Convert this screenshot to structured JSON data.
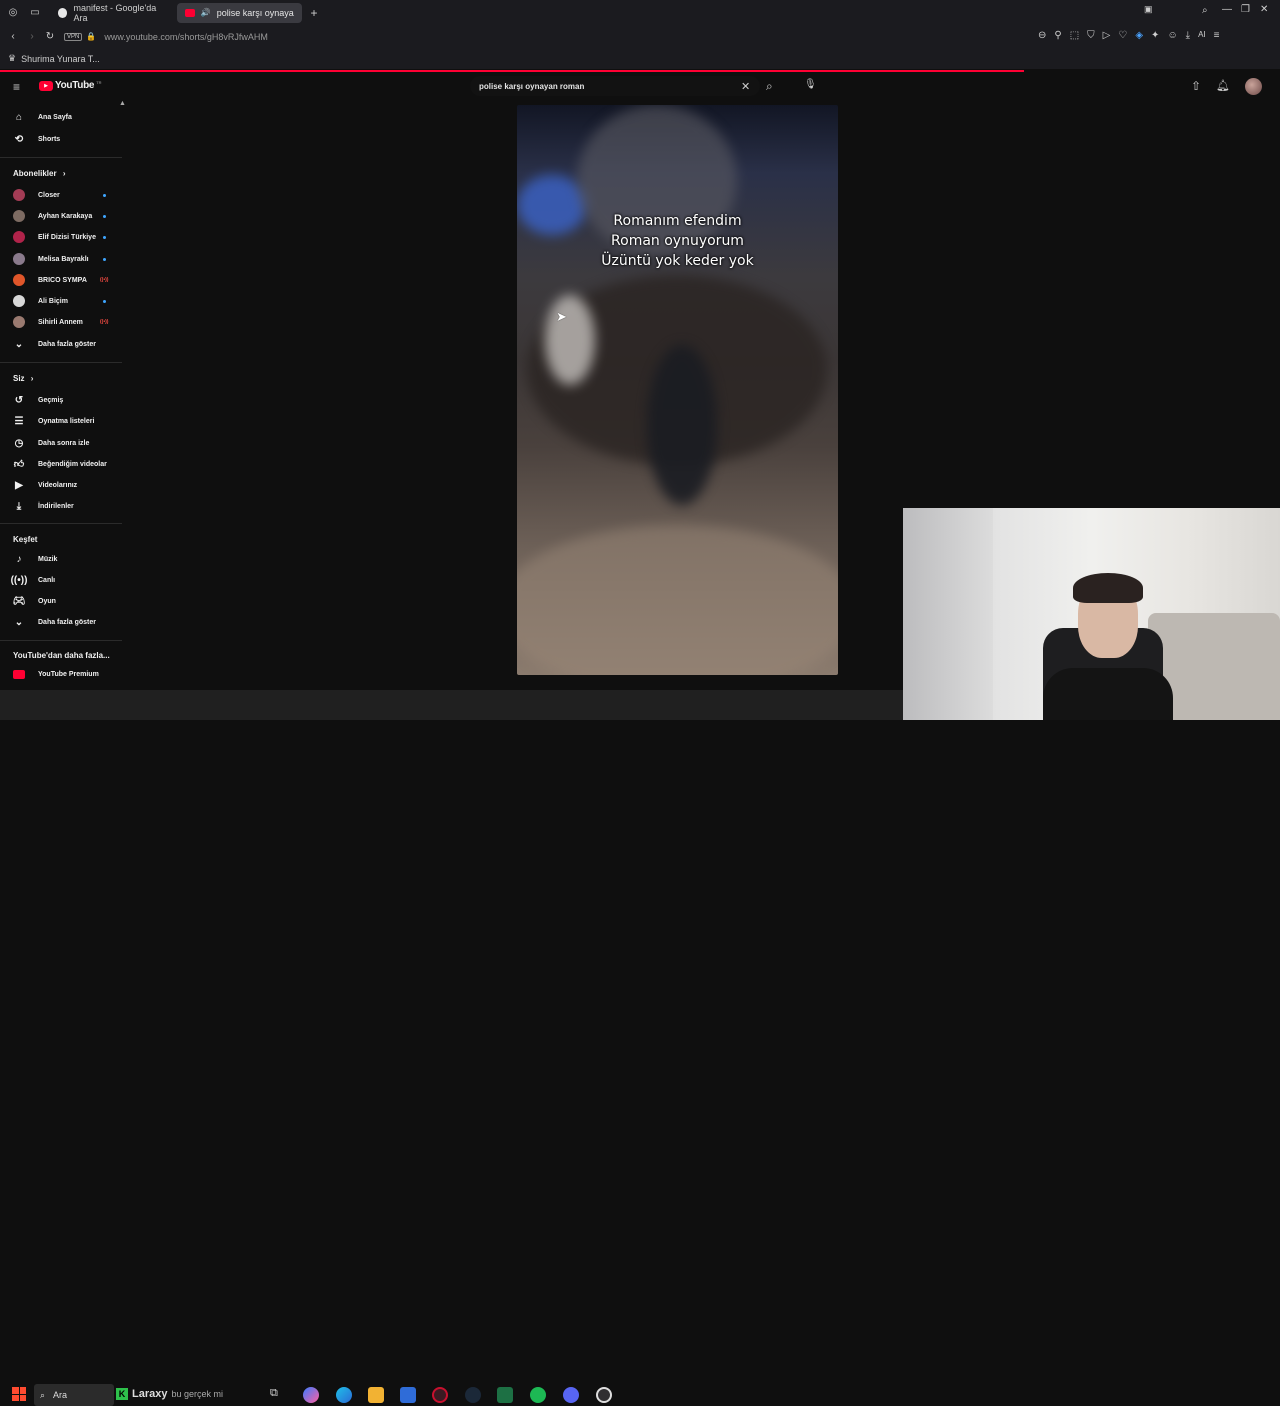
{
  "browser": {
    "tabs": [
      {
        "title": "manifest - Google'da Ara",
        "active": false
      },
      {
        "title": "polise karşı oynayan r",
        "active": true
      }
    ],
    "vpn_label": "VPN",
    "url": "www.youtube.com/shorts/gH8vRJfwAHM",
    "bookmark": "Shurima Yunara T...",
    "ai_label": "AI"
  },
  "youtube": {
    "logo_text": "YouTube",
    "logo_badge": "TR",
    "search_query": "polise karşı oynayan roman",
    "sidebar": {
      "main": [
        {
          "label": "Ana Sayfa",
          "icon": "home-icon"
        },
        {
          "label": "Shorts",
          "icon": "shorts-icon"
        }
      ],
      "subscriptions_title": "Abonelikler",
      "subscriptions": [
        {
          "label": "Closer",
          "color": "#a33c55",
          "badge": "dot"
        },
        {
          "label": "Ayhan Karakaya",
          "color": "#7d6b62",
          "badge": "dot"
        },
        {
          "label": "Elif Dizisi Türkiye",
          "color": "#b0234a",
          "badge": "dot"
        },
        {
          "label": "Melisa Bayraklı",
          "color": "#8a7a8c",
          "badge": "dot"
        },
        {
          "label": "BRICO SYMPA",
          "color": "#e0562a",
          "badge": "live"
        },
        {
          "label": "Ali Biçim",
          "color": "#d8d8d8",
          "badge": "dot"
        },
        {
          "label": "Sihirli Annem",
          "color": "#9a7a70",
          "badge": "live"
        }
      ],
      "show_more": "Daha fazla göster",
      "you_title": "Siz",
      "you": [
        {
          "label": "Geçmiş",
          "icon": "history-icon"
        },
        {
          "label": "Oynatma listeleri",
          "icon": "playlist-icon"
        },
        {
          "label": "Daha sonra izle",
          "icon": "clock-icon"
        },
        {
          "label": "Beğendiğim videolar",
          "icon": "thumbs-up-icon"
        },
        {
          "label": "Videolarınız",
          "icon": "video-icon"
        },
        {
          "label": "İndirilenler",
          "icon": "download-icon"
        }
      ],
      "explore_title": "Keşfet",
      "explore": [
        {
          "label": "Müzik",
          "icon": "music-icon"
        },
        {
          "label": "Canlı",
          "icon": "live-icon"
        },
        {
          "label": "Oyun",
          "icon": "gaming-icon"
        }
      ],
      "explore_more": "Daha fazla göster",
      "more_title": "YouTube'dan daha fazla...",
      "premium": "YouTube Premium"
    },
    "video_caption": [
      "Romanım efendim",
      "Roman oynuyorum",
      "Üzüntü yok keder yok"
    ]
  },
  "taskbar": {
    "search_label": "Ara",
    "widget_text": "Laraxy",
    "widget_sub": "bu gerçek mi"
  },
  "colors": {
    "accent": "#ff0033",
    "background": "#0f0f0f",
    "sub_dot": "#3ea6ff"
  },
  "page_progress": 0.8
}
